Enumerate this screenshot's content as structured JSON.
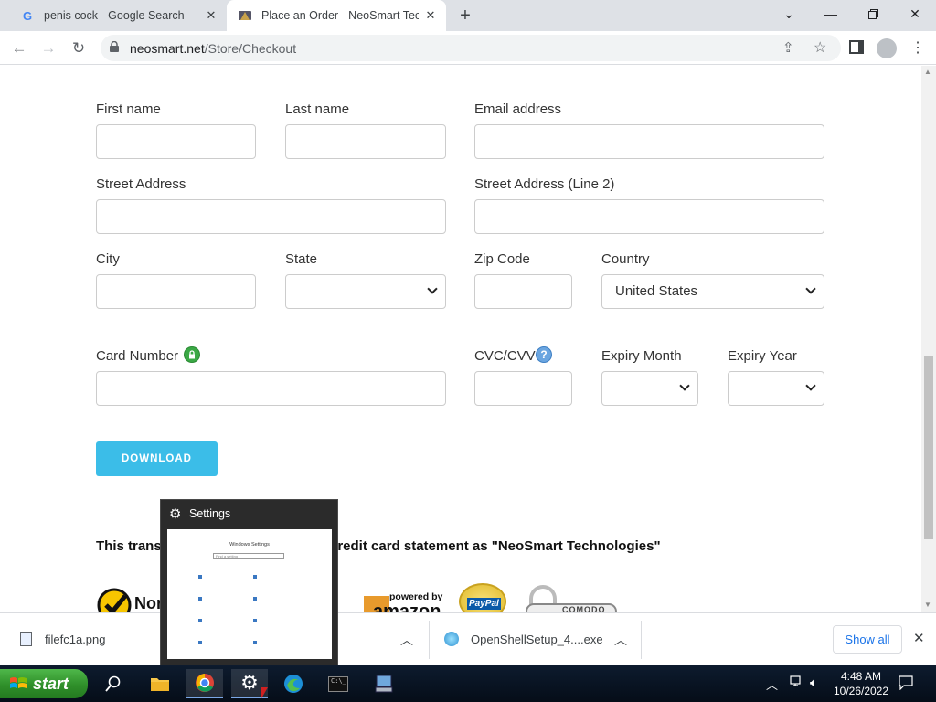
{
  "browser": {
    "tabs": [
      {
        "title": "penis cock - Google Search",
        "favicon": "google-g"
      },
      {
        "title": "Place an Order - NeoSmart Techn",
        "favicon": "neosmart"
      }
    ],
    "new_tab": "+",
    "url_host": "neosmart.net",
    "url_path": "/Store/Checkout"
  },
  "form": {
    "first_name_label": "First name",
    "last_name_label": "Last name",
    "email_label": "Email address",
    "street_label": "Street Address",
    "street2_label": "Street Address (Line 2)",
    "city_label": "City",
    "state_label": "State",
    "state_value": "",
    "zip_label": "Zip Code",
    "country_label": "Country",
    "country_value": "United States",
    "card_label": "Card Number",
    "cvc_label": "CVC/CVV",
    "expiry_month_label": "Expiry Month",
    "expiry_year_label": "Expiry Year",
    "submit_label": "DOWNLOAD",
    "statement_text_left": "This transa",
    "statement_text_right": "credit card statement as \"NeoSmart Technologies\""
  },
  "badges": {
    "norton": "Nort",
    "amazon_top": "powered by",
    "amazon_bottom": "amazon",
    "paypal": "PayPal",
    "comodo": "COMODO"
  },
  "downloads": {
    "items": [
      {
        "name": "filefc1a.png"
      },
      {
        "name": "OpenShellSetup_4....exe"
      }
    ],
    "show_all": "Show all"
  },
  "thumbnail": {
    "title": "Settings",
    "preview_title": "Windows Settings",
    "preview_search": "Find a setting"
  },
  "taskbar": {
    "start_label": "start",
    "time": "4:48 AM",
    "date": "10/26/2022"
  },
  "colors": {
    "accent_button": "#3bbde8",
    "tab_strip": "#dee1e6",
    "taskbar": "#0d1b2e"
  }
}
